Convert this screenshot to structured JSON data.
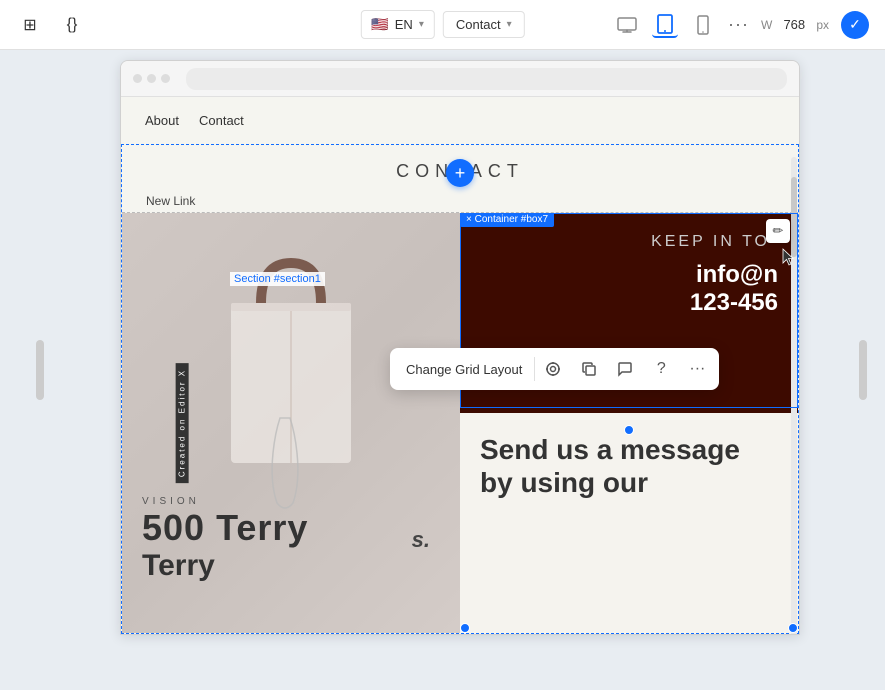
{
  "toolbar": {
    "lang": "EN",
    "page": "Contact",
    "width_label": "W",
    "width_value": "768",
    "width_unit": "px",
    "dots": "···",
    "icons": {
      "grid": "⊞",
      "code": "{}",
      "desktop": "🖥",
      "tablet": "▭",
      "mobile": "📱"
    }
  },
  "nav": {
    "about": "About",
    "contact": "Contact",
    "new_link": "New Link",
    "section_label": "Section #section1"
  },
  "contact": {
    "title": "CONTACT",
    "add_btn": "+",
    "container_badge": "× Container #box7"
  },
  "left_cell": {
    "vision_label": "VISION",
    "vision_number": "500 Terry",
    "created_label": "Created on Editor X",
    "brand": "s."
  },
  "right_cell": {
    "keep_in_touch": "KEEP IN TO",
    "email": "info@n",
    "phone": "123-456",
    "send_message": "Send us a message",
    "by_using": "by using our"
  },
  "grid_toolbar": {
    "label": "Change Grid Layout",
    "icons": {
      "target": "◎",
      "copy": "⧉",
      "chat": "💬",
      "help": "?",
      "more": "···"
    }
  }
}
